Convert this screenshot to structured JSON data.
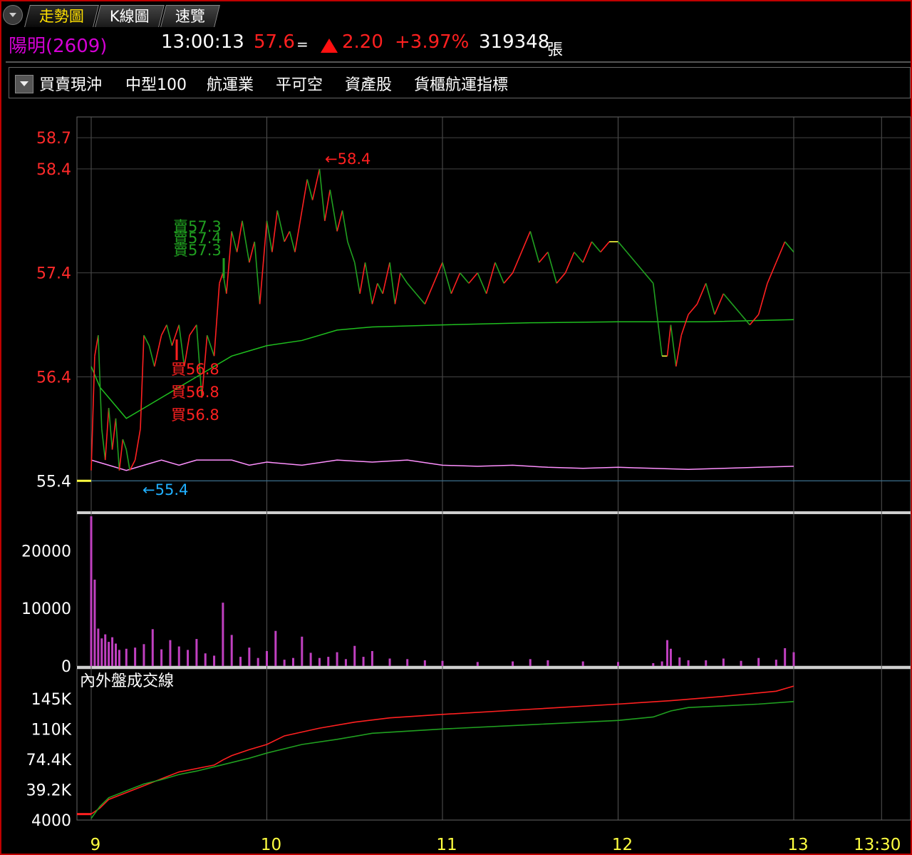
{
  "tabs": [
    {
      "label": "走勢圖",
      "active": true
    },
    {
      "label": "K線圖",
      "active": false
    },
    {
      "label": "速覽",
      "active": false
    }
  ],
  "quote": {
    "name": "陽明(2609)",
    "time": "13:00:13",
    "price": "57.6",
    "flat_sign": "=",
    "change": "2.20",
    "change_pct": "+3.97%",
    "volume": "319348",
    "volume_unit": "張"
  },
  "tags": [
    "買賣現沖",
    "中型100",
    "航運業",
    "平可空",
    "資產股",
    "貨櫃航運指標"
  ],
  "colors": {
    "up": "#ff2020",
    "down": "#20a020",
    "avg": "#1fbf1f",
    "mark": "#ffff40",
    "pink": "#ff90ff",
    "volume": "#c040c0",
    "limitline": "#20b0ff"
  },
  "chart_data": [
    {
      "type": "line",
      "title": "",
      "ylim": [
        55.1,
        58.9
      ],
      "y_ticks": [
        "58.7",
        "58.4",
        "57.4",
        "56.4",
        "55.4"
      ],
      "x_ticks": [
        "9",
        "10",
        "11",
        "12",
        "13",
        "13:30"
      ],
      "annotations": {
        "high": "←58.4",
        "low": "←55.4",
        "buy1": "買56.8",
        "buy2": "買56.8",
        "buy3": "買56.8",
        "sell1": "賣57.3",
        "sell2": "賣57.4",
        "sell3": "賣57.3"
      },
      "series": [
        {
          "x": [
            9.0,
            9.02,
            9.04,
            9.06,
            9.08,
            9.1,
            9.12,
            9.14,
            9.16,
            9.18,
            9.2,
            9.22,
            9.25,
            9.28,
            9.3,
            9.33,
            9.36,
            9.4,
            9.43,
            9.46,
            9.5,
            9.53,
            9.56,
            9.6,
            9.63,
            9.66,
            9.7,
            9.73,
            9.75,
            9.77,
            9.8,
            9.83,
            9.86,
            9.9,
            9.93,
            9.96,
            10.0,
            10.03,
            10.06,
            10.1,
            10.13,
            10.16,
            10.2,
            10.23,
            10.26,
            10.3,
            10.33,
            10.36,
            10.4,
            10.43,
            10.46,
            10.5,
            10.53,
            10.56,
            10.6,
            10.63,
            10.66,
            10.7,
            10.73,
            10.76,
            10.8,
            10.85,
            10.9,
            10.95,
            11.0,
            11.05,
            11.1,
            11.15,
            11.2,
            11.25,
            11.3,
            11.35,
            11.4,
            11.45,
            11.5,
            11.55,
            11.6,
            11.65,
            11.7,
            11.75,
            11.8,
            11.85,
            11.9,
            11.95,
            12.0,
            12.05,
            12.1,
            12.15,
            12.2,
            12.25,
            12.28,
            12.3,
            12.33,
            12.36,
            12.4,
            12.45,
            12.5,
            12.55,
            12.6,
            12.65,
            12.7,
            12.75,
            12.8,
            12.85,
            12.9,
            12.95,
            13.0
          ],
          "y": [
            55.5,
            56.6,
            56.8,
            55.9,
            55.6,
            56.1,
            55.7,
            56.0,
            55.5,
            55.8,
            55.7,
            55.5,
            55.6,
            55.9,
            56.8,
            56.7,
            56.5,
            56.8,
            56.9,
            56.7,
            56.9,
            56.5,
            56.8,
            56.9,
            56.2,
            56.8,
            56.6,
            57.3,
            57.4,
            57.2,
            57.8,
            57.6,
            57.9,
            57.5,
            57.7,
            57.1,
            57.9,
            57.6,
            58.0,
            57.7,
            57.8,
            57.6,
            58.0,
            58.3,
            58.1,
            58.4,
            57.9,
            58.2,
            57.8,
            58.0,
            57.7,
            57.5,
            57.2,
            57.5,
            57.1,
            57.3,
            57.2,
            57.5,
            57.1,
            57.4,
            57.3,
            57.2,
            57.1,
            57.3,
            57.5,
            57.2,
            57.4,
            57.3,
            57.4,
            57.2,
            57.5,
            57.3,
            57.4,
            57.6,
            57.8,
            57.5,
            57.6,
            57.3,
            57.4,
            57.6,
            57.5,
            57.7,
            57.6,
            57.7,
            57.7,
            57.6,
            57.5,
            57.4,
            57.3,
            56.6,
            56.6,
            56.9,
            56.5,
            56.8,
            57.0,
            57.1,
            57.3,
            57.0,
            57.2,
            57.1,
            57.0,
            56.9,
            57.0,
            57.3,
            57.5,
            57.7,
            57.6
          ],
          "name": ""
        },
        {
          "x": [
            9.0,
            9.05,
            9.1,
            9.2,
            9.3,
            9.4,
            9.5,
            9.6,
            9.7,
            9.8,
            9.9,
            10.0,
            10.2,
            10.4,
            10.6,
            11.0,
            11.5,
            12.0,
            12.5,
            13.0
          ],
          "y": [
            56.5,
            56.3,
            56.2,
            56.0,
            56.1,
            56.2,
            56.3,
            56.4,
            56.5,
            56.6,
            56.65,
            56.7,
            56.75,
            56.85,
            56.88,
            56.9,
            56.92,
            56.93,
            56.93,
            56.95
          ],
          "name": ""
        },
        {
          "x": [
            9.0,
            9.1,
            9.2,
            9.3,
            9.4,
            9.5,
            9.6,
            9.7,
            9.8,
            9.9,
            10.0,
            10.2,
            10.4,
            10.6,
            10.8,
            11.0,
            11.2,
            11.4,
            11.6,
            11.8,
            12.0,
            12.2,
            12.4,
            12.6,
            12.8,
            13.0
          ],
          "y": [
            55.6,
            55.55,
            55.5,
            55.55,
            55.6,
            55.55,
            55.6,
            55.6,
            55.6,
            55.55,
            55.58,
            55.55,
            55.6,
            55.58,
            55.6,
            55.55,
            55.54,
            55.55,
            55.53,
            55.52,
            55.53,
            55.52,
            55.51,
            55.52,
            55.53,
            55.54
          ],
          "name": ""
        }
      ]
    },
    {
      "type": "bar",
      "title": "",
      "ylim": [
        0,
        26000
      ],
      "y_ticks": [
        "20000",
        "10000",
        "0"
      ],
      "x": [
        9.0,
        9.02,
        9.04,
        9.06,
        9.08,
        9.1,
        9.12,
        9.14,
        9.16,
        9.2,
        9.25,
        9.3,
        9.35,
        9.4,
        9.45,
        9.5,
        9.55,
        9.6,
        9.65,
        9.7,
        9.75,
        9.8,
        9.85,
        9.9,
        9.95,
        10.0,
        10.05,
        10.1,
        10.15,
        10.2,
        10.25,
        10.3,
        10.35,
        10.4,
        10.45,
        10.5,
        10.55,
        10.6,
        10.7,
        10.8,
        10.9,
        11.0,
        11.2,
        11.4,
        11.5,
        11.6,
        11.8,
        12.0,
        12.2,
        12.25,
        12.28,
        12.3,
        12.35,
        12.4,
        12.5,
        12.6,
        12.7,
        12.8,
        12.9,
        12.95,
        13.0
      ],
      "values": [
        26000,
        15000,
        6500,
        4800,
        5500,
        4200,
        5000,
        3900,
        2800,
        3000,
        3200,
        3800,
        6400,
        2900,
        4500,
        3400,
        2800,
        4700,
        2200,
        1800,
        11000,
        5400,
        1600,
        3200,
        1400,
        2600,
        6100,
        1100,
        1400,
        5100,
        2300,
        1400,
        1600,
        2400,
        1200,
        3500,
        1600,
        2600,
        1300,
        1200,
        1000,
        900,
        700,
        800,
        1200,
        1000,
        800,
        700,
        500,
        800,
        4500,
        3000,
        1500,
        1000,
        1000,
        1300,
        900,
        1400,
        1100,
        3100,
        2400
      ],
      "x_ticks": [
        "9",
        "10",
        "11",
        "12",
        "13",
        "13:30"
      ]
    },
    {
      "type": "line",
      "title": "內外盤成交線",
      "ylim": [
        4000,
        180000
      ],
      "y_ticks": [
        "145K",
        "110K",
        "74.4K",
        "39.2K",
        "4000"
      ],
      "x_ticks": [
        "9",
        "10",
        "11",
        "12",
        "13",
        "13:30"
      ],
      "series": [
        {
          "x": [
            9.0,
            9.05,
            9.1,
            9.2,
            9.3,
            9.4,
            9.5,
            9.6,
            9.7,
            9.75,
            9.8,
            9.9,
            10.0,
            10.1,
            10.3,
            10.5,
            10.7,
            11.0,
            11.5,
            12.0,
            12.3,
            12.6,
            12.8,
            12.9,
            13.0
          ],
          "y": [
            11000,
            18000,
            28000,
            36000,
            44000,
            52000,
            60000,
            64000,
            68000,
            74000,
            79000,
            86000,
            92000,
            102000,
            111000,
            118000,
            123000,
            127000,
            133000,
            139000,
            143000,
            148000,
            152000,
            154000,
            160000
          ],
          "name": ""
        },
        {
          "x": [
            9.0,
            9.05,
            9.1,
            9.2,
            9.3,
            9.4,
            9.5,
            9.6,
            9.7,
            9.8,
            9.9,
            10.0,
            10.2,
            10.4,
            10.6,
            11.0,
            11.5,
            12.0,
            12.2,
            12.3,
            12.4,
            12.6,
            12.8,
            13.0
          ],
          "y": [
            6000,
            20000,
            30000,
            38000,
            46000,
            51000,
            57000,
            61000,
            66000,
            71000,
            76000,
            82000,
            92000,
            98000,
            105000,
            110000,
            115000,
            120000,
            124000,
            131000,
            135000,
            137000,
            139000,
            142000
          ],
          "name": ""
        }
      ]
    }
  ]
}
